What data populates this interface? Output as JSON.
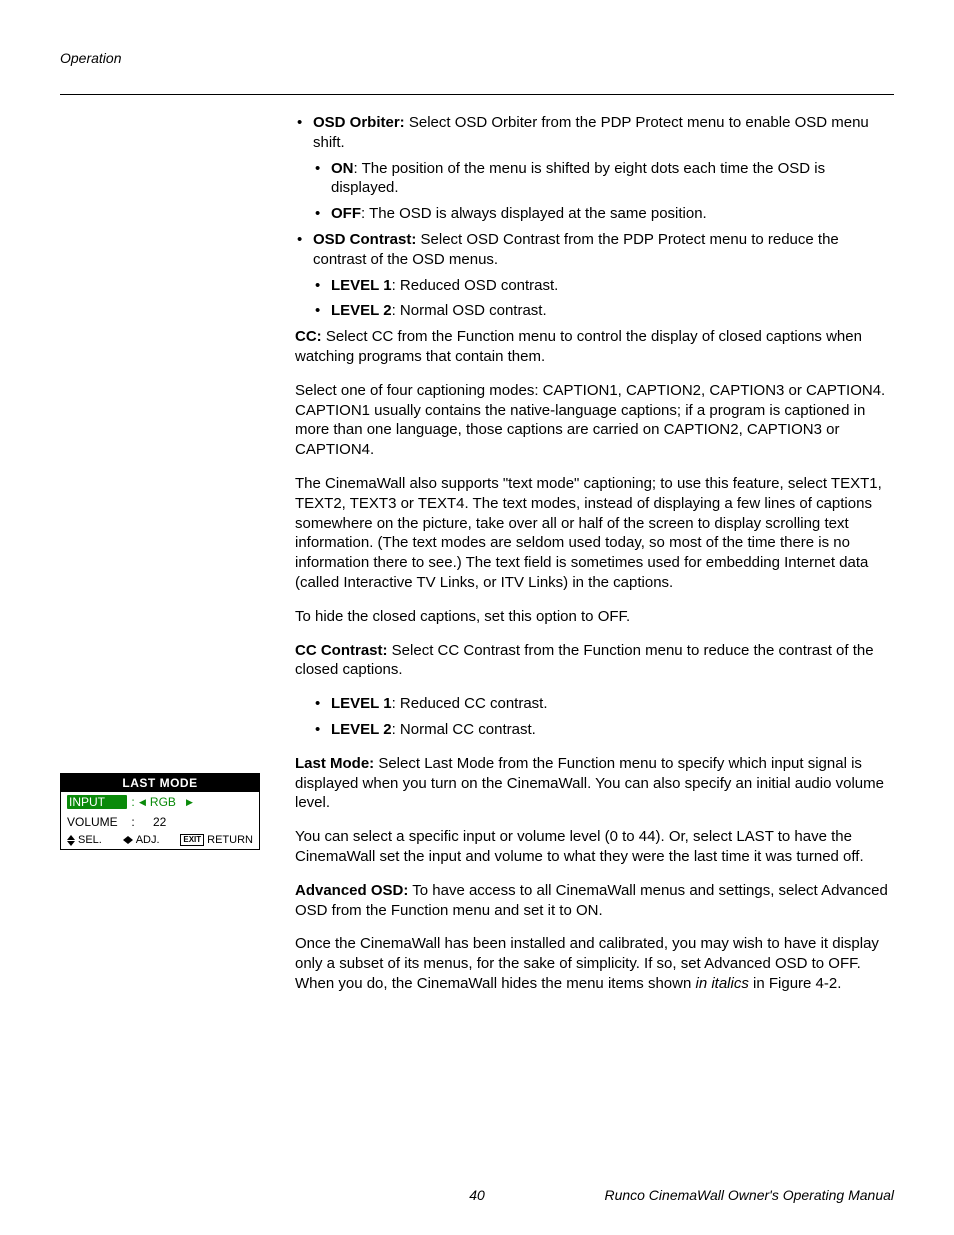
{
  "header": {
    "section": "Operation"
  },
  "bullets": {
    "osd_orbiter": {
      "label": "OSD Orbiter:",
      "text": " Select OSD Orbiter from the PDP Protect menu to enable OSD menu shift.",
      "on_label": "ON",
      "on_text": ": The position of the menu is shifted by eight dots each time the OSD is displayed.",
      "off_label": "OFF",
      "off_text": ": The OSD is always displayed at the same position."
    },
    "osd_contrast": {
      "label": "OSD Contrast:",
      "text": " Select OSD Contrast from the PDP Protect menu to reduce the contrast of the OSD menus.",
      "l1_label": "LEVEL 1",
      "l1_text": ": Reduced OSD contrast.",
      "l2_label": "LEVEL 2",
      "l2_text": ": Normal OSD contrast."
    }
  },
  "cc": {
    "label": "CC:",
    "text": " Select CC from the Function menu to control the display of closed captions when watching programs that contain them."
  },
  "cc_modes": "Select one of four captioning modes: CAPTION1, CAPTION2, CAPTION3 or CAPTION4. CAPTION1 usually contains the native-language captions; if a program is captioned in more than one language, those captions are carried on CAPTION2, CAPTION3 or CAPTION4.",
  "cc_text": "The CinemaWall also supports \"text mode\" captioning; to use this feature, select TEXT1, TEXT2, TEXT3 or TEXT4. The text modes, instead of displaying a few lines of captions somewhere on the picture, take over all or half of the screen to display scrolling text information. (The text modes are seldom used today, so most of the time there is no information there to see.) The text field is sometimes used for embedding Internet data (called Interactive TV Links, or ITV Links) in the captions.",
  "cc_hide": "To hide the closed captions, set this option to OFF.",
  "cc_contrast": {
    "label": "CC Contrast:",
    "text": " Select CC Contrast from the Function menu to reduce the contrast of the closed captions.",
    "l1_label": "LEVEL 1",
    "l1_text": ": Reduced CC contrast.",
    "l2_label": "LEVEL 2",
    "l2_text": ": Normal CC contrast."
  },
  "last_mode": {
    "label": "Last Mode:",
    "text": " Select Last Mode from the Function menu to specify which input signal is displayed when you turn on the CinemaWall. You can also specify an initial audio volume level."
  },
  "last_mode_p2": "You can select a specific input or volume level (0 to 44). Or, select LAST to have the CinemaWall set the input and volume to what they were the last time it was turned off.",
  "adv_osd": {
    "label": "Advanced OSD:",
    "text": " To have access to all CinemaWall menus and settings, select Advanced OSD from the Function menu and set it to ON."
  },
  "adv_osd_p2_a": "Once the CinemaWall has been installed and calibrated, you may wish to have it display only a subset of its menus, for the sake of simplicity. If so, set Advanced OSD to OFF. When you do, the CinemaWall hides the menu items shown ",
  "adv_osd_p2_italic": "in italics",
  "adv_osd_p2_b": " in Figure 4-2.",
  "osd": {
    "title": "LAST MODE",
    "rows": [
      {
        "key": "INPUT",
        "sep": ":",
        "value": "RGB",
        "selected": true
      },
      {
        "key": "VOLUME",
        "sep": ":",
        "value": "22",
        "selected": false
      }
    ],
    "footer": {
      "sel": "SEL.",
      "adj": "ADJ.",
      "exit": "EXIT",
      "ret": "RETURN"
    }
  },
  "footer": {
    "page": "40",
    "doc": "Runco CinemaWall Owner's Operating Manual"
  }
}
